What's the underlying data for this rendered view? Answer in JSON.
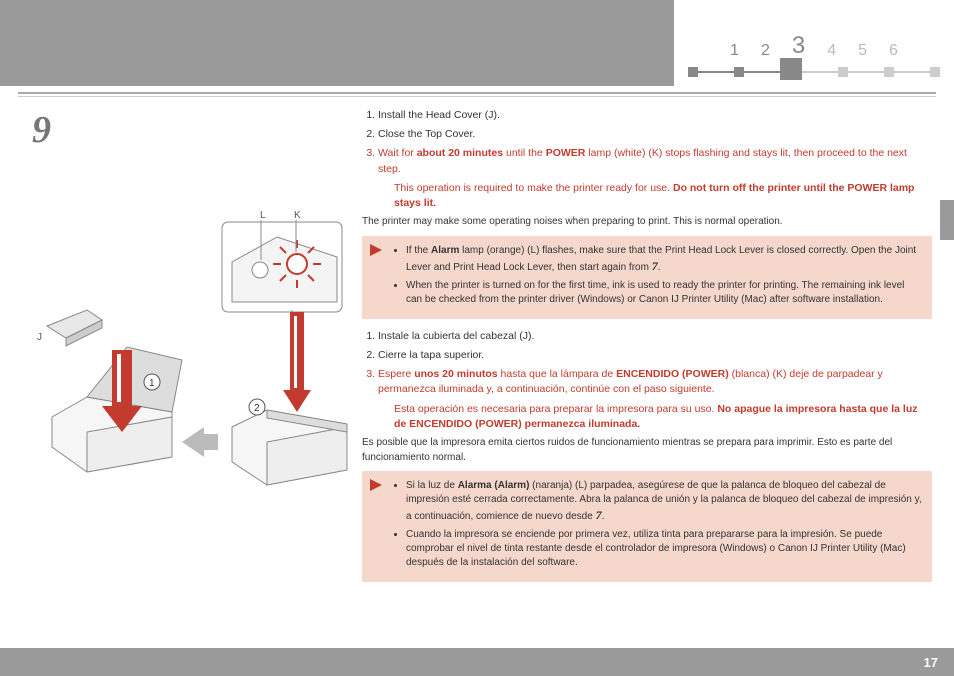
{
  "nav": {
    "n1": "1",
    "n2": "2",
    "n3": "3",
    "n4": "4",
    "n5": "5",
    "n6": "6"
  },
  "stepNumber": "9",
  "pageNumber": "17",
  "diagram": {
    "J": "J",
    "L": "L",
    "K": "K",
    "c1": "1",
    "c2": "2"
  },
  "en": {
    "s1": "Install the Head Cover (J).",
    "s2": "Close the Top Cover.",
    "s3a": "Wait for ",
    "s3b": "about 20 minutes",
    "s3c": " until the ",
    "s3d": "POWER",
    "s3e": " lamp (white) (K) stops flashing and stays lit, then proceed to the next step.",
    "s3note1": "This operation is required to make the printer ready for use. ",
    "s3note2": "Do not turn off the printer until the POWER lamp stays lit.",
    "small": "The printer may make some operating noises when preparing to print. This is normal operation.",
    "a1a": "If the ",
    "a1b": "Alarm",
    "a1c": " lamp (orange) (L) flashes, make sure that the Print Head Lock Lever is closed correctly. Open the Joint Lever and Print Head Lock Lever, then start again from ",
    "a2": "When the printer is turned on for the first time, ink is used to ready the printer for printing. The remaining ink level can be checked from the printer driver (Windows) or Canon IJ Printer Utility (Mac) after software installation."
  },
  "es": {
    "s1": "Instale la cubierta del cabezal (J).",
    "s2": "Cierre la tapa superior.",
    "s3a": "Espere ",
    "s3b": "unos 20 minutos",
    "s3c": " hasta que la lámpara de ",
    "s3d": "ENCENDIDO (POWER)",
    "s3e": " (blanca) (K) deje de parpadear y permanezca iluminada y, a continuación, continúe con el paso siguiente.",
    "s3note1": "Esta operación es necesaria para preparar la impresora para su uso. ",
    "s3note2": "No apague la impresora hasta que la luz de ENCENDIDO (POWER) permanezca iluminada.",
    "small": "Es posible que la impresora emita ciertos ruidos de funcionamiento mientras se prepara para imprimir. Esto es parte del funcionamiento normal.",
    "a1a": "Si la luz de ",
    "a1b": "Alarma (Alarm)",
    "a1c": " (naranja) (L) parpadea, asegúrese de que la palanca de bloqueo del cabezal de impresión esté cerrada correctamente. Abra la palanca de unión y la palanca de bloqueo del cabezal de impresión y, a continuación, comience de nuevo desde ",
    "a2": "Cuando la impresora se enciende por primera vez, utiliza tinta para prepararse para la impresión. Se puede comprobar el nivel de tinta restante desde el controlador de impresora (Windows) o Canon IJ Printer Utility (Mac) después de la instalación del software."
  },
  "seven": "7",
  "period": "."
}
